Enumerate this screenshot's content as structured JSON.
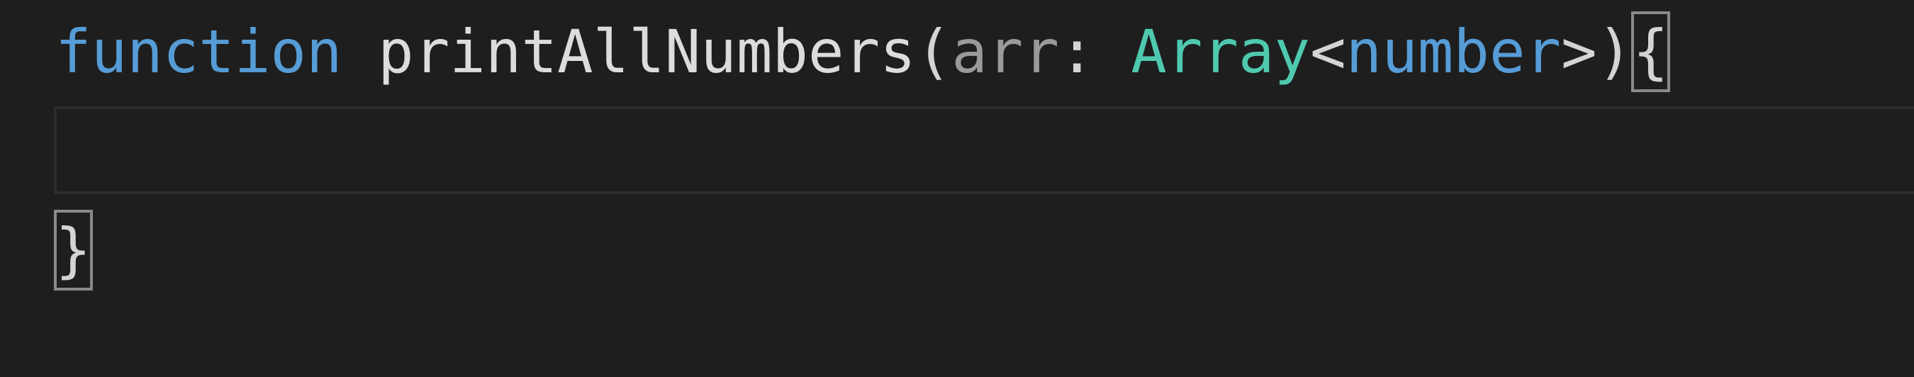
{
  "editor": {
    "line1": {
      "keyword": "function",
      "function_name": "printAllNumbers",
      "open_paren": "(",
      "param_name": "arr",
      "colon": ":",
      "type_name": "Array",
      "lt": "<",
      "generic_type": "number",
      "gt": ">",
      "close_paren": ")",
      "open_brace": "{"
    },
    "line2": {
      "text": ""
    },
    "line3": {
      "close_brace": "}"
    }
  },
  "colors": {
    "background": "#1e1e1e",
    "keyword": "#569cd6",
    "type": "#4ec9b0",
    "parameter": "#9a9a9a",
    "text": "#d4d4d4",
    "current_line_border": "#2c2c2c",
    "bracket_match_border": "#8a8a8a"
  }
}
